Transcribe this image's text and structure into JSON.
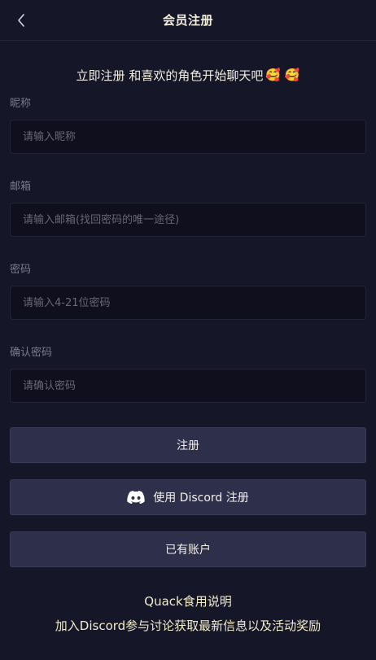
{
  "header": {
    "title": "会员注册"
  },
  "intro": {
    "text": "立即注册 和喜欢的角色开始聊天吧",
    "emojis": "🥰 🥰"
  },
  "form": {
    "nickname": {
      "label": "昵称",
      "placeholder": "请输入昵称"
    },
    "email": {
      "label": "邮箱",
      "placeholder": "请输入邮箱(找回密码的唯一途径)"
    },
    "password": {
      "label": "密码",
      "placeholder": "请输入4-21位密码"
    },
    "confirm_password": {
      "label": "确认密码",
      "placeholder": "请确认密码"
    }
  },
  "buttons": {
    "register": "注册",
    "discord_register": "使用 Discord 注册",
    "have_account": "已有账户"
  },
  "footer": {
    "guide_link": "Quack食用说明",
    "discord_join_link": "加入Discord参与讨论获取最新信息以及活动奖励"
  },
  "colors": {
    "background": "#161629",
    "input_background": "#0f0f1e",
    "button_background": "#2e2f4b",
    "title_text": "#f2eedb",
    "footer_text": "#f2eccc"
  },
  "icons": {
    "back": "chevron-left-icon",
    "discord": "discord-icon"
  }
}
